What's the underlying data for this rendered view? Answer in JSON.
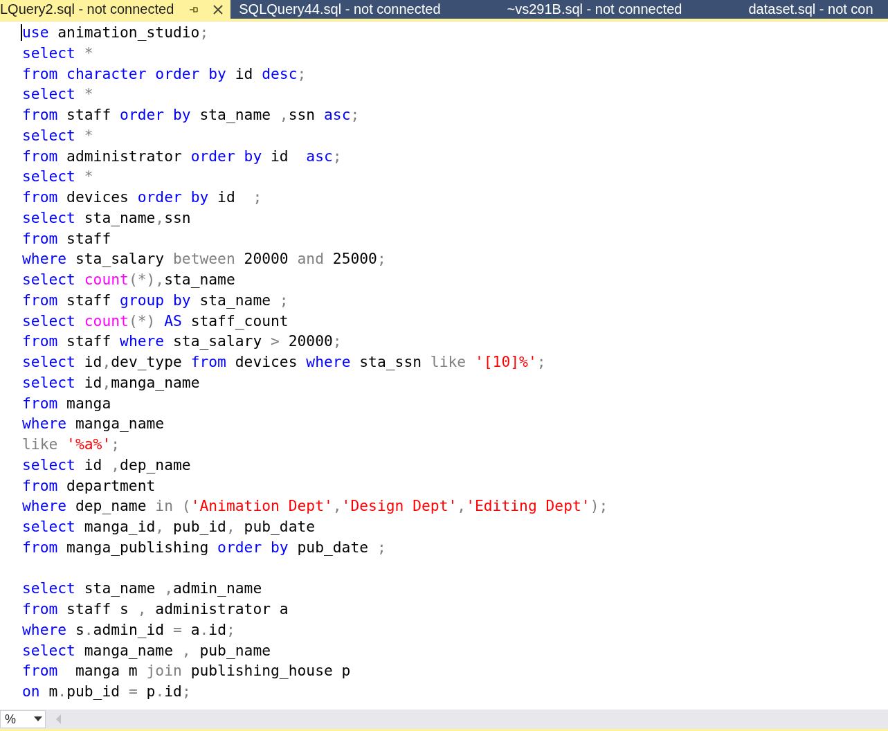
{
  "tabs": [
    {
      "label": "LQuery2.sql - not connected",
      "selected": true
    },
    {
      "label": "SQLQuery44.sql - not connected",
      "selected": false
    },
    {
      "label": "~vs291B.sql - not connected",
      "selected": false
    },
    {
      "label": "dataset.sql - not con",
      "selected": false
    }
  ],
  "editor": {
    "lines": [
      {
        "kind": "code",
        "tokens": [
          {
            "kind": "keyword",
            "text": "use"
          },
          {
            "kind": "plain",
            "text": " animation_studio"
          },
          {
            "kind": "operator",
            "text": ";"
          }
        ]
      },
      {
        "kind": "code",
        "tokens": [
          {
            "kind": "keyword",
            "text": "select"
          },
          {
            "kind": "operator",
            "text": " *"
          }
        ]
      },
      {
        "kind": "code",
        "tokens": [
          {
            "kind": "keyword",
            "text": "from"
          },
          {
            "kind": "keyword",
            "text": " character order by"
          },
          {
            "kind": "plain",
            "text": " id "
          },
          {
            "kind": "keyword",
            "text": "desc"
          },
          {
            "kind": "operator",
            "text": ";"
          }
        ]
      },
      {
        "kind": "code",
        "tokens": [
          {
            "kind": "keyword",
            "text": "select"
          },
          {
            "kind": "operator",
            "text": " *"
          }
        ]
      },
      {
        "kind": "code",
        "tokens": [
          {
            "kind": "keyword",
            "text": "from"
          },
          {
            "kind": "plain",
            "text": " staff "
          },
          {
            "kind": "keyword",
            "text": "order by"
          },
          {
            "kind": "plain",
            "text": " sta_name "
          },
          {
            "kind": "operator",
            "text": ","
          },
          {
            "kind": "plain",
            "text": "ssn "
          },
          {
            "kind": "keyword",
            "text": "asc"
          },
          {
            "kind": "operator",
            "text": ";"
          }
        ]
      },
      {
        "kind": "code",
        "tokens": [
          {
            "kind": "keyword",
            "text": "select"
          },
          {
            "kind": "operator",
            "text": " *"
          }
        ]
      },
      {
        "kind": "code",
        "tokens": [
          {
            "kind": "keyword",
            "text": "from"
          },
          {
            "kind": "plain",
            "text": " administrator "
          },
          {
            "kind": "keyword",
            "text": "order by"
          },
          {
            "kind": "plain",
            "text": " id  "
          },
          {
            "kind": "keyword",
            "text": "asc"
          },
          {
            "kind": "operator",
            "text": ";"
          }
        ]
      },
      {
        "kind": "code",
        "tokens": [
          {
            "kind": "keyword",
            "text": "select"
          },
          {
            "kind": "operator",
            "text": " *"
          }
        ]
      },
      {
        "kind": "code",
        "tokens": [
          {
            "kind": "keyword",
            "text": "from"
          },
          {
            "kind": "plain",
            "text": " devices "
          },
          {
            "kind": "keyword",
            "text": "order by"
          },
          {
            "kind": "plain",
            "text": " id  "
          },
          {
            "kind": "operator",
            "text": ";"
          }
        ]
      },
      {
        "kind": "code",
        "tokens": [
          {
            "kind": "keyword",
            "text": "select"
          },
          {
            "kind": "plain",
            "text": " sta_name"
          },
          {
            "kind": "operator",
            "text": ","
          },
          {
            "kind": "plain",
            "text": "ssn"
          }
        ]
      },
      {
        "kind": "code",
        "tokens": [
          {
            "kind": "keyword",
            "text": "from"
          },
          {
            "kind": "plain",
            "text": " staff"
          }
        ]
      },
      {
        "kind": "code",
        "tokens": [
          {
            "kind": "keyword",
            "text": "where"
          },
          {
            "kind": "plain",
            "text": " sta_salary "
          },
          {
            "kind": "operator",
            "text": "between"
          },
          {
            "kind": "plain",
            "text": " 20000 "
          },
          {
            "kind": "operator",
            "text": "and"
          },
          {
            "kind": "plain",
            "text": " 25000"
          },
          {
            "kind": "operator",
            "text": ";"
          }
        ]
      },
      {
        "kind": "code",
        "tokens": [
          {
            "kind": "keyword",
            "text": "select"
          },
          {
            "kind": "function",
            "text": " count"
          },
          {
            "kind": "operator",
            "text": "(*),"
          },
          {
            "kind": "plain",
            "text": "sta_name"
          }
        ]
      },
      {
        "kind": "code",
        "tokens": [
          {
            "kind": "keyword",
            "text": "from"
          },
          {
            "kind": "plain",
            "text": " staff "
          },
          {
            "kind": "keyword",
            "text": "group by"
          },
          {
            "kind": "plain",
            "text": " sta_name "
          },
          {
            "kind": "operator",
            "text": ";"
          }
        ]
      },
      {
        "kind": "code",
        "tokens": [
          {
            "kind": "keyword",
            "text": "select"
          },
          {
            "kind": "function",
            "text": " count"
          },
          {
            "kind": "operator",
            "text": "(*)"
          },
          {
            "kind": "keyword",
            "text": " AS"
          },
          {
            "kind": "plain",
            "text": " staff_count"
          }
        ]
      },
      {
        "kind": "code",
        "tokens": [
          {
            "kind": "keyword",
            "text": "from"
          },
          {
            "kind": "plain",
            "text": " staff "
          },
          {
            "kind": "keyword",
            "text": "where"
          },
          {
            "kind": "plain",
            "text": " sta_salary "
          },
          {
            "kind": "operator",
            "text": ">"
          },
          {
            "kind": "plain",
            "text": " 20000"
          },
          {
            "kind": "operator",
            "text": ";"
          }
        ]
      },
      {
        "kind": "code",
        "tokens": [
          {
            "kind": "keyword",
            "text": "select"
          },
          {
            "kind": "plain",
            "text": " id"
          },
          {
            "kind": "operator",
            "text": ","
          },
          {
            "kind": "plain",
            "text": "dev_type "
          },
          {
            "kind": "keyword",
            "text": "from"
          },
          {
            "kind": "plain",
            "text": " devices "
          },
          {
            "kind": "keyword",
            "text": "where"
          },
          {
            "kind": "plain",
            "text": " sta_ssn "
          },
          {
            "kind": "operator",
            "text": "like"
          },
          {
            "kind": "string",
            "text": " '[10]%'"
          },
          {
            "kind": "operator",
            "text": ";"
          }
        ]
      },
      {
        "kind": "code",
        "tokens": [
          {
            "kind": "keyword",
            "text": "select"
          },
          {
            "kind": "plain",
            "text": " id"
          },
          {
            "kind": "operator",
            "text": ","
          },
          {
            "kind": "plain",
            "text": "manga_name"
          }
        ]
      },
      {
        "kind": "code",
        "tokens": [
          {
            "kind": "keyword",
            "text": "from"
          },
          {
            "kind": "plain",
            "text": " manga"
          }
        ]
      },
      {
        "kind": "code",
        "tokens": [
          {
            "kind": "keyword",
            "text": "where"
          },
          {
            "kind": "plain",
            "text": " manga_name"
          }
        ]
      },
      {
        "kind": "code",
        "tokens": [
          {
            "kind": "operator",
            "text": "like"
          },
          {
            "kind": "string",
            "text": " '%a%'"
          },
          {
            "kind": "operator",
            "text": ";"
          }
        ]
      },
      {
        "kind": "code",
        "tokens": [
          {
            "kind": "keyword",
            "text": "select"
          },
          {
            "kind": "plain",
            "text": " id "
          },
          {
            "kind": "operator",
            "text": ","
          },
          {
            "kind": "plain",
            "text": "dep_name"
          }
        ]
      },
      {
        "kind": "code",
        "tokens": [
          {
            "kind": "keyword",
            "text": "from"
          },
          {
            "kind": "plain",
            "text": " department"
          }
        ]
      },
      {
        "kind": "code",
        "tokens": [
          {
            "kind": "keyword",
            "text": "where"
          },
          {
            "kind": "plain",
            "text": " dep_name "
          },
          {
            "kind": "operator",
            "text": "in ("
          },
          {
            "kind": "string",
            "text": "'Animation Dept'"
          },
          {
            "kind": "operator",
            "text": ","
          },
          {
            "kind": "string",
            "text": "'Design Dept'"
          },
          {
            "kind": "operator",
            "text": ","
          },
          {
            "kind": "string",
            "text": "'Editing Dept'"
          },
          {
            "kind": "operator",
            "text": ");"
          }
        ]
      },
      {
        "kind": "code",
        "tokens": [
          {
            "kind": "keyword",
            "text": "select"
          },
          {
            "kind": "plain",
            "text": " manga_id"
          },
          {
            "kind": "operator",
            "text": ","
          },
          {
            "kind": "plain",
            "text": " pub_id"
          },
          {
            "kind": "operator",
            "text": ","
          },
          {
            "kind": "plain",
            "text": " pub_date"
          }
        ]
      },
      {
        "kind": "code",
        "tokens": [
          {
            "kind": "keyword",
            "text": "from"
          },
          {
            "kind": "plain",
            "text": " manga_publishing "
          },
          {
            "kind": "keyword",
            "text": "order by"
          },
          {
            "kind": "plain",
            "text": " pub_date "
          },
          {
            "kind": "operator",
            "text": ";"
          }
        ]
      },
      {
        "kind": "blank"
      },
      {
        "kind": "code",
        "tokens": [
          {
            "kind": "keyword",
            "text": "select"
          },
          {
            "kind": "plain",
            "text": " sta_name "
          },
          {
            "kind": "operator",
            "text": ","
          },
          {
            "kind": "plain",
            "text": "admin_name"
          }
        ]
      },
      {
        "kind": "code",
        "tokens": [
          {
            "kind": "keyword",
            "text": "from"
          },
          {
            "kind": "plain",
            "text": " staff s "
          },
          {
            "kind": "operator",
            "text": ","
          },
          {
            "kind": "plain",
            "text": " administrator a"
          }
        ]
      },
      {
        "kind": "code",
        "tokens": [
          {
            "kind": "keyword",
            "text": "where"
          },
          {
            "kind": "plain",
            "text": " s"
          },
          {
            "kind": "operator",
            "text": "."
          },
          {
            "kind": "plain",
            "text": "admin_id "
          },
          {
            "kind": "operator",
            "text": "="
          },
          {
            "kind": "plain",
            "text": " a"
          },
          {
            "kind": "operator",
            "text": "."
          },
          {
            "kind": "plain",
            "text": "id"
          },
          {
            "kind": "operator",
            "text": ";"
          }
        ]
      },
      {
        "kind": "code",
        "tokens": [
          {
            "kind": "keyword",
            "text": "select"
          },
          {
            "kind": "plain",
            "text": " manga_name "
          },
          {
            "kind": "operator",
            "text": ","
          },
          {
            "kind": "plain",
            "text": " pub_name"
          }
        ]
      },
      {
        "kind": "code",
        "tokens": [
          {
            "kind": "keyword",
            "text": "from"
          },
          {
            "kind": "plain",
            "text": "  manga m "
          },
          {
            "kind": "operator",
            "text": "join"
          },
          {
            "kind": "plain",
            "text": " publishing_house p"
          }
        ]
      },
      {
        "kind": "code",
        "tokens": [
          {
            "kind": "keyword",
            "text": "on"
          },
          {
            "kind": "plain",
            "text": " m"
          },
          {
            "kind": "operator",
            "text": "."
          },
          {
            "kind": "plain",
            "text": "pub_id "
          },
          {
            "kind": "operator",
            "text": "="
          },
          {
            "kind": "plain",
            "text": " p"
          },
          {
            "kind": "operator",
            "text": "."
          },
          {
            "kind": "plain",
            "text": "id"
          },
          {
            "kind": "operator",
            "text": ";"
          }
        ]
      }
    ]
  },
  "status_bar": {
    "zoom": "%"
  }
}
